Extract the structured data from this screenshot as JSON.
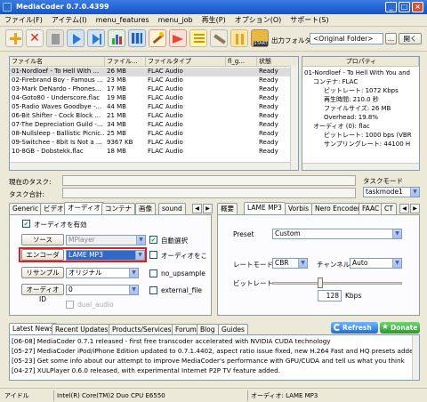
{
  "window": {
    "title": "MediaCoder 0.7.0.4399"
  },
  "menu": [
    "ファイル(F)",
    "アイテム(I)",
    "menu_features",
    "menu_job",
    "再生(P)",
    "オプション(O)",
    "サポート(S)"
  ],
  "toolbar": {
    "output_folder_label": "出力フォルダ",
    "output_folder_value": "<Original Folder>",
    "browse_btn": "...",
    "open_btn": "開く"
  },
  "files": {
    "columns": [
      "ファイル名",
      "ファイル...",
      "ファイルタイプ",
      "fl_g...",
      "状態"
    ],
    "rows": [
      {
        "name": "01-Nordloef - To Hell With ...",
        "size": "26 MB",
        "type": "FLAC Audio",
        "fg": "",
        "state": "Ready"
      },
      {
        "name": "02-Firebrand Boy - Famous ...",
        "size": "23 MB",
        "type": "FLAC Audio",
        "fg": "",
        "state": "Ready"
      },
      {
        "name": "03-Mark DeNardo - Phones...",
        "size": "17 MB",
        "type": "FLAC Audio",
        "fg": "",
        "state": "Ready"
      },
      {
        "name": "04-Goto80 - Underscore.flac",
        "size": "19 MB",
        "type": "FLAC Audio",
        "fg": "",
        "state": "Ready"
      },
      {
        "name": "05-Radio Waves Goodbye -...",
        "size": "44 MB",
        "type": "FLAC Audio",
        "fg": "",
        "state": "Ready"
      },
      {
        "name": "06-Bit Shifter - Cock Block ...",
        "size": "21 MB",
        "type": "FLAC Audio",
        "fg": "",
        "state": "Ready"
      },
      {
        "name": "07-The Depreciation Guild -...",
        "size": "34 MB",
        "type": "FLAC Audio",
        "fg": "",
        "state": "Ready"
      },
      {
        "name": "08-Nullsleep - Ballistic Picnic...",
        "size": "25 MB",
        "type": "FLAC Audio",
        "fg": "",
        "state": "Ready"
      },
      {
        "name": "09-Switchee - 8bit Is Not a ...",
        "size": "9367 KB",
        "type": "FLAC Audio",
        "fg": "",
        "state": "Ready"
      },
      {
        "name": "10-8GB - Dobstekk.flac",
        "size": "18 MB",
        "type": "FLAC Audio",
        "fg": "",
        "state": "Ready"
      }
    ]
  },
  "props": {
    "header": "プロパティ",
    "lines": [
      "01-Nordloef - To Hell With You and",
      "コンテナ: FLAC",
      "ビットレート: 1072 Kbps",
      "再生時間: 210.0 秒",
      "ファイルサイズ: 26 MB",
      "Overhead: 19.8%",
      "オーディオ (0): flac",
      "ビットレート: 1000 bps (VBR",
      "サンプリングレート: 44100 H"
    ]
  },
  "task": {
    "current_label": "現在のタスク:",
    "total_label": "タスク合計:",
    "taskmode_label": "タスクモード",
    "taskmode_value": "taskmode1"
  },
  "left_tabs": [
    "Generic",
    "ビデオ",
    "オーディオ",
    "コンテナ",
    "画像",
    "sound"
  ],
  "audio": {
    "enable_label": "オーディオを有効",
    "source_btn": "ソース",
    "source_value": "MPlayer",
    "auto_select": "自動選択",
    "encoder_btn": "エンコーダ",
    "encoder_value": "LAME MP3",
    "audio_other": "オーディオをこ",
    "resample_btn": "リサンプル",
    "resample_value": "オリジナル",
    "no_upsample": "no_upsample",
    "audio_id_btn": "オーディオ ID",
    "audio_id_value": "0",
    "external_file": "external_file",
    "dual_audio": "dual_audio"
  },
  "right_tabs": [
    "概要",
    "LAME MP3",
    "Vorbis",
    "Nero Encoder",
    "FAAC",
    "CT"
  ],
  "lame": {
    "preset_label": "Preset",
    "preset_value": "Custom",
    "ratemode_label": "レートモード",
    "ratemode_value": "CBR",
    "channel_label": "チャンネル",
    "channel_value": "Auto",
    "bitrate_label": "ビットレート",
    "bitrate_value": "128",
    "bitrate_unit": "Kbps"
  },
  "news": {
    "tabs": [
      "Latest News",
      "Recent Updates",
      "Products/Services",
      "Forum",
      "Blog",
      "Guides"
    ],
    "refresh": "Refresh",
    "donate": "Donate",
    "items": [
      "[06-08] MediaCoder 0.7.1 released - first free transcoder accelerated with NVIDIA CUDA technology",
      "[05-27] MediaCoder iPod/iPhone Edition updated to 0.7.1.4402, aspect ratio issue fixed, new H.264 Fast and HQ presets added.",
      "[05-23] Get some info about our attempt to improve MediaCoder's performance with GPU/CUDA and tell us what you think",
      "[04-27] XULPlayer 0.6.0 released, with experimental Internet P2P TV feature added."
    ]
  },
  "status": {
    "state": "アイドル",
    "cpu": "Intel(R) Core(TM)2 Duo CPU E6550",
    "info": "オーディオ: LAME MP3"
  }
}
